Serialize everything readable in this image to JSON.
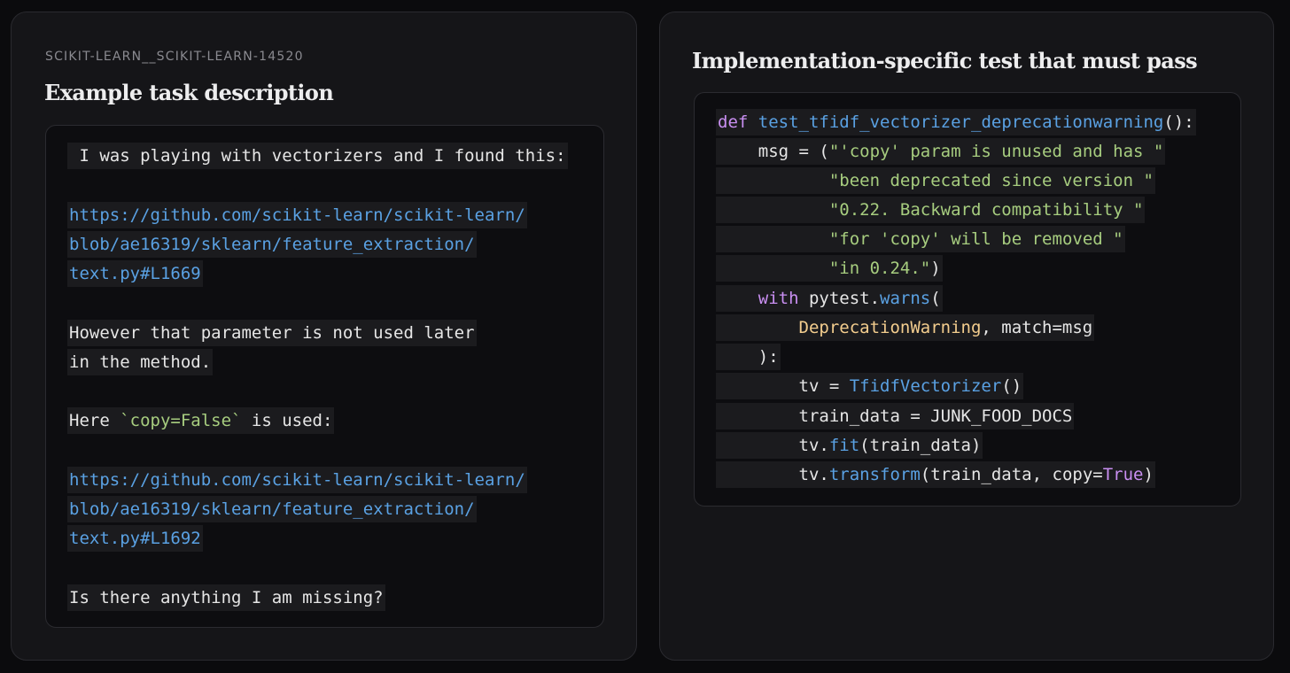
{
  "left": {
    "eyebrow": "SCIKIT-LEARN__SCIKIT-LEARN-14520",
    "title": "Example task description",
    "lines": {
      "l1": " I was playing with vectorizers and I found this:",
      "link1a": "https://github.com/scikit-learn/scikit-learn/",
      "link1b": "blob/ae16319/sklearn/feature_extraction/",
      "link1c": "text.py#L1669",
      "l3a": "However that parameter is not used later",
      "l3b": "in the method.",
      "l4_prefix": "Here ",
      "l4_code": "`copy=False`",
      "l4_suffix": " is used:",
      "link2a": "https://github.com/scikit-learn/scikit-learn/",
      "link2b": "blob/ae16319/sklearn/feature_extraction/",
      "link2c": "text.py#L1692",
      "l6": "Is there anything I am missing?"
    }
  },
  "right": {
    "title": "Implementation-specific test that must pass",
    "code": {
      "c1_kw": "def",
      "c1_fn": "test_tfidf_vectorizer_deprecationwarning",
      "c1_rest": "():",
      "c2_pre": "    msg = (",
      "c2_str": "\"'copy' param is unused and has \"",
      "c3_str": "\"been deprecated since version \"",
      "c4_str": "\"0.22. Backward compatibility \"",
      "c5_str": "\"for 'copy' will be removed \"",
      "c6_str": "\"in 0.24.\"",
      "c6_rest": ")",
      "c7_kw": "with",
      "c7_mid": " pytest.",
      "c7_fn": "warns",
      "c7_rest": "(",
      "c8_cls": "DeprecationWarning",
      "c8_rest": ", match=msg",
      "c9": "    ):",
      "c10_pre": "        tv = ",
      "c10_fn": "TfidfVectorizer",
      "c10_rest": "()",
      "c11": "        train_data = JUNK_FOOD_DOCS",
      "c12_pre": "        tv.",
      "c12_fn": "fit",
      "c12_rest": "(train_data)",
      "c13_pre": "        tv.",
      "c13_fn": "transform",
      "c13_mid": "(train_data, copy=",
      "c13_kw": "True",
      "c13_rest": ")"
    }
  }
}
